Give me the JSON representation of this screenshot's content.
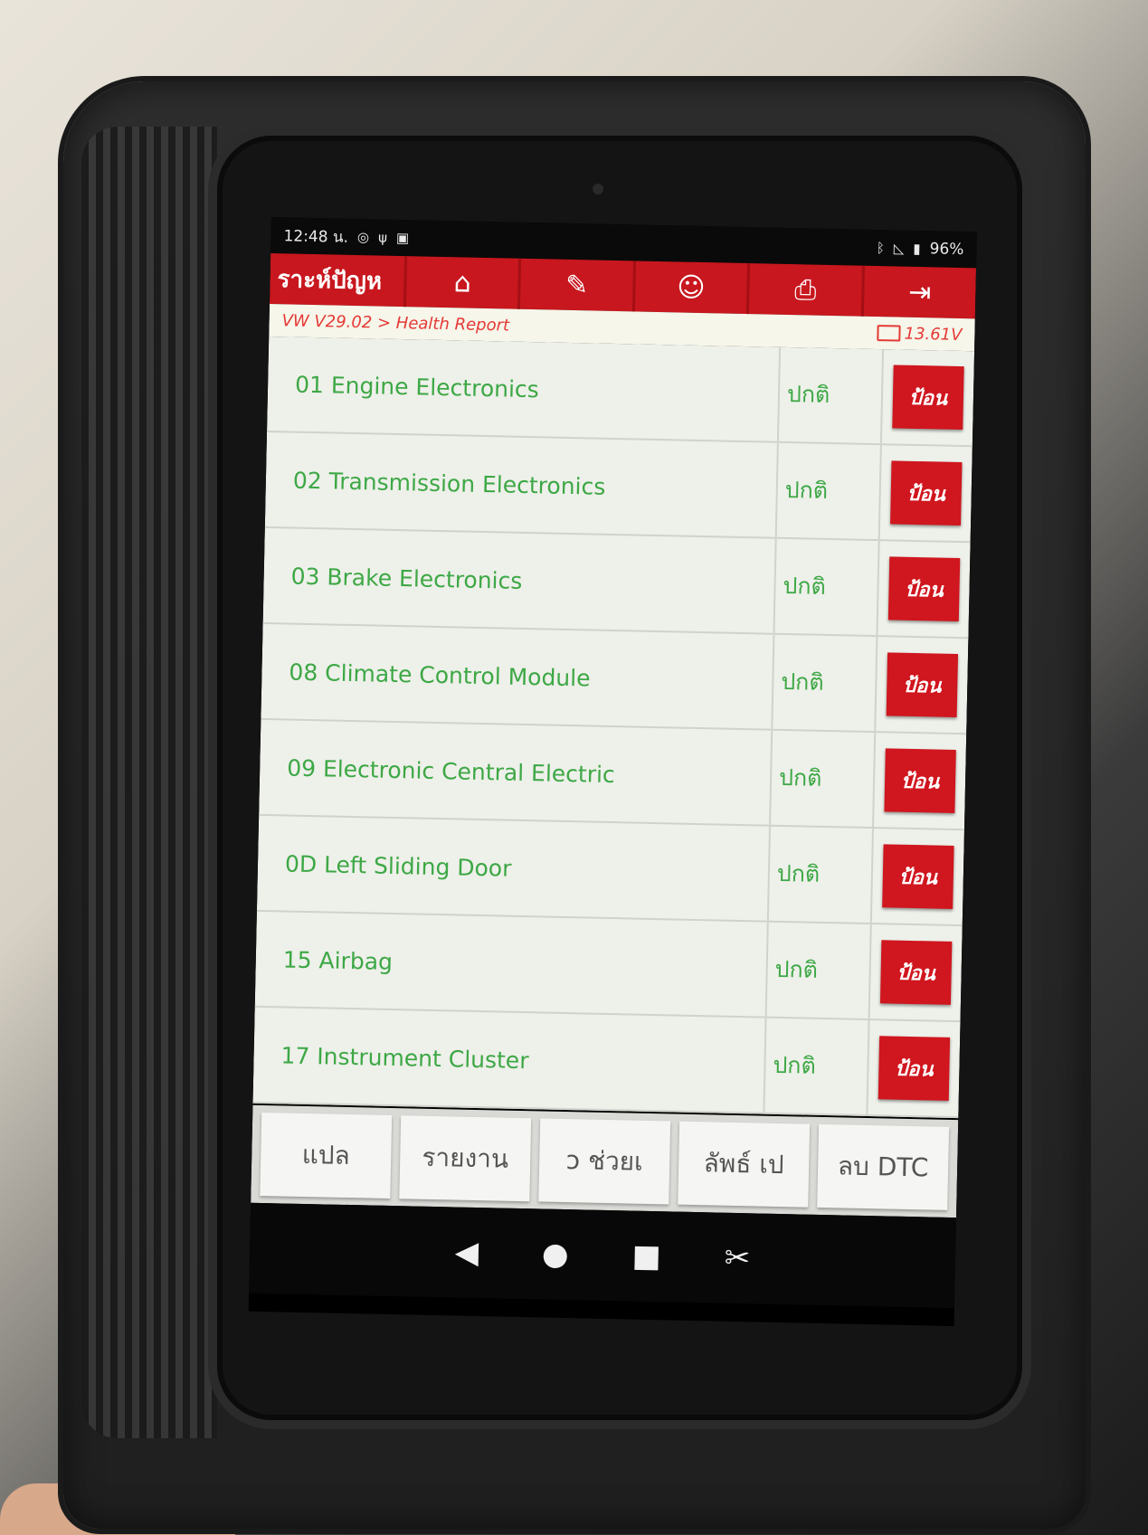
{
  "status_bar": {
    "time": "12:48 น.",
    "battery": "96%"
  },
  "app_bar": {
    "title": "ราะห์ปัญห",
    "tools": [
      {
        "icon": "home-icon",
        "glyph": "⌂"
      },
      {
        "icon": "edit-icon",
        "glyph": "✎"
      },
      {
        "icon": "user-icon",
        "glyph": "☺"
      },
      {
        "icon": "print-icon",
        "glyph": "⎙"
      },
      {
        "icon": "exit-icon",
        "glyph": "⇥"
      }
    ]
  },
  "breadcrumb": {
    "path": "VW V29.02 > Health Report",
    "voltage": "13.61V"
  },
  "rows": [
    {
      "name": "01 Engine Electronics",
      "status": "ปกติ",
      "action": "ป้อน"
    },
    {
      "name": "02 Transmission Electronics",
      "status": "ปกติ",
      "action": "ป้อน"
    },
    {
      "name": "03 Brake Electronics",
      "status": "ปกติ",
      "action": "ป้อน"
    },
    {
      "name": "08 Climate Control Module",
      "status": "ปกติ",
      "action": "ป้อน"
    },
    {
      "name": "09 Electronic Central Electric",
      "status": "ปกติ",
      "action": "ป้อน"
    },
    {
      "name": "0D Left Sliding Door",
      "status": "ปกติ",
      "action": "ป้อน"
    },
    {
      "name": "15 Airbag",
      "status": "ปกติ",
      "action": "ป้อน"
    },
    {
      "name": "17 Instrument Cluster",
      "status": "ปกติ",
      "action": "ป้อน"
    }
  ],
  "bottom_bar": {
    "buttons": [
      "แปล",
      "รายงาน",
      "ɔ    ช่วยเ",
      "ลัพธ์   เป",
      "ลบ DTC"
    ]
  },
  "colors": {
    "brand_red": "#c8171e",
    "ok_green": "#3da845",
    "breadcrumb_red": "#e53935"
  }
}
